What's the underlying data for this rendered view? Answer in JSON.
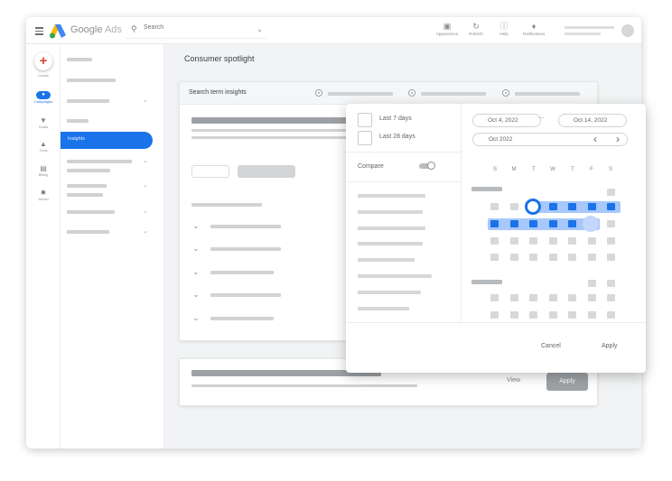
{
  "app": {
    "brand_google": "Google",
    "brand_ads": "Ads",
    "search_placeholder": "Search"
  },
  "topbar": {
    "items": [
      {
        "icon": "appearance-icon",
        "label": "Appearance"
      },
      {
        "icon": "refresh-icon",
        "label": "Refresh"
      },
      {
        "icon": "help-icon",
        "label": "Help"
      },
      {
        "icon": "bell-icon",
        "label": "Notifications"
      }
    ]
  },
  "rail": {
    "create_label": "Create",
    "items": [
      {
        "icon": "campaigns-icon",
        "label": "Campaigns",
        "active": true
      },
      {
        "icon": "goals-icon",
        "label": "Goals"
      },
      {
        "icon": "tools-icon",
        "label": "Tools"
      },
      {
        "icon": "billing-icon",
        "label": "Billing"
      },
      {
        "icon": "admin-icon",
        "label": "Admin"
      }
    ]
  },
  "nav": {
    "active_label": "Insights"
  },
  "main": {
    "page_title": "Consumer spotlight",
    "card_title": "Search term insights",
    "view_label": "View",
    "apply_label": "Apply"
  },
  "picker": {
    "last7": "Last 7 days",
    "last28": "Last 28 days",
    "compare": "Compare",
    "compare_on": true,
    "start_date": "Oct 4, 2022",
    "end_date": "Oct 14, 2022",
    "separator": "—",
    "month": "Oct 2022",
    "days": [
      "S",
      "M",
      "T",
      "W",
      "T",
      "F",
      "S"
    ],
    "cancel": "Cancel",
    "apply": "Apply"
  },
  "colors": {
    "accent": "#1a73e8",
    "range": "#a8c7fa"
  }
}
